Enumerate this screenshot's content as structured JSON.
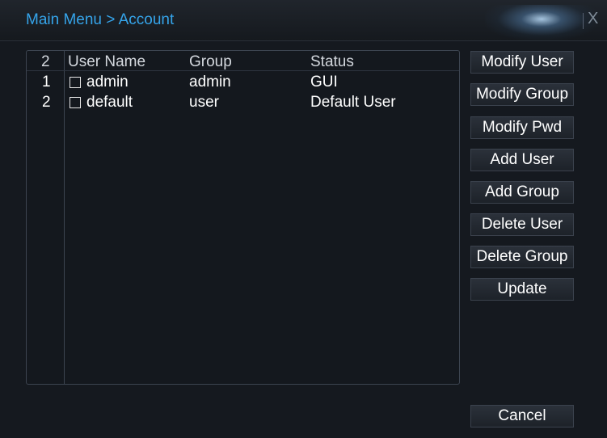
{
  "window": {
    "title": "Main Menu > Account",
    "close_label": "X"
  },
  "list": {
    "count": "2",
    "headers": {
      "user_name": "User Name",
      "group": "Group",
      "status": "Status"
    },
    "rows": [
      {
        "index": "1",
        "user_name": "admin",
        "group": "admin",
        "status": "GUI"
      },
      {
        "index": "2",
        "user_name": "default",
        "group": "user",
        "status": "Default User"
      }
    ]
  },
  "buttons": {
    "modify_user": "Modify User",
    "modify_group": "Modify Group",
    "modify_pwd": "Modify Pwd",
    "add_user": "Add User",
    "add_group": "Add Group",
    "delete_user": "Delete User",
    "delete_group": "Delete Group",
    "update": "Update",
    "cancel": "Cancel"
  },
  "colors": {
    "title": "#35a4ea",
    "background": "#15191f",
    "text": "#ffffff"
  }
}
